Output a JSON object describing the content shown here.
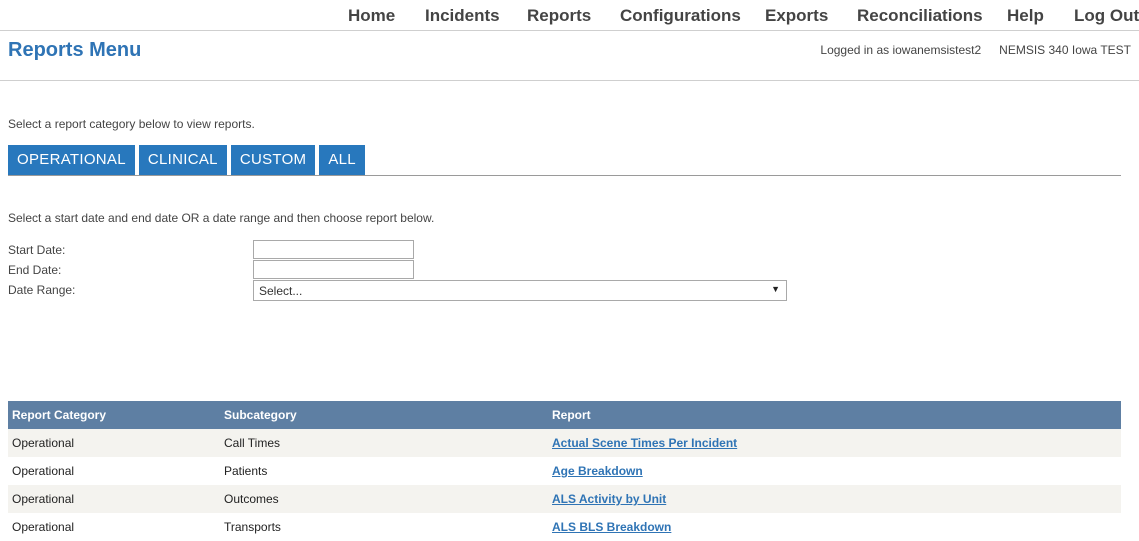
{
  "nav": {
    "items": [
      "Home",
      "Incidents",
      "Reports",
      "Configurations",
      "Exports",
      "Reconciliations",
      "Help",
      "Log Out"
    ]
  },
  "header": {
    "title": "Reports Menu",
    "logged_in": "Logged in as iowanemsistest2",
    "system": "NEMSIS 340 Iowa TEST"
  },
  "intro_text": "Select a report category below to view reports.",
  "tabs": [
    "OPERATIONAL",
    "CLINICAL",
    "CUSTOM",
    "ALL"
  ],
  "date_form": {
    "instructions": "Select a start date and end date OR a date range and then choose report below.",
    "start_label": "Start Date:",
    "start_value": "",
    "end_label": "End Date:",
    "end_value": "",
    "range_label": "Date Range:",
    "range_selected": "Select..."
  },
  "table": {
    "headers": [
      "Report Category",
      "Subcategory",
      "Report"
    ],
    "rows": [
      [
        "Operational",
        "Call Times",
        "Actual Scene Times Per Incident"
      ],
      [
        "Operational",
        "Patients",
        "Age Breakdown"
      ],
      [
        "Operational",
        "Outcomes",
        "ALS Activity by Unit"
      ],
      [
        "Operational",
        "Transports",
        "ALS BLS Breakdown"
      ]
    ]
  },
  "colors": {
    "title": "#2f74b5",
    "tab_bg": "#2878bd",
    "table_header_bg": "#5e7fa3",
    "link": "#2f74b5",
    "row_alt": "#f4f3ef"
  }
}
